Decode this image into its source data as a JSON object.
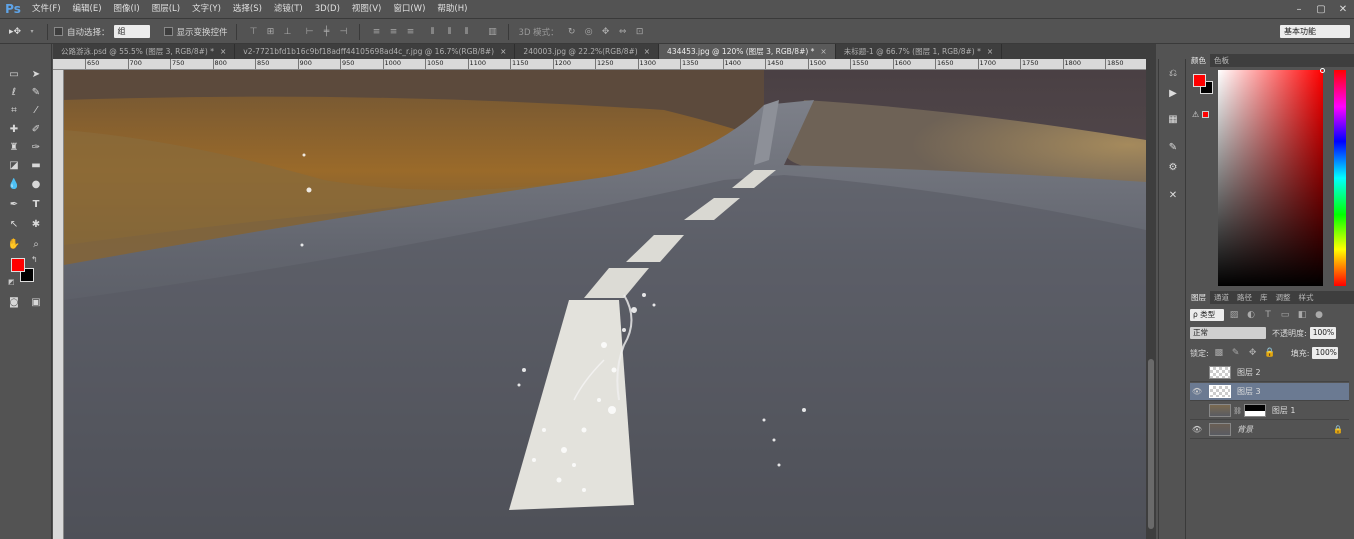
{
  "app": {
    "logo": "Ps"
  },
  "menu": [
    "文件(F)",
    "编辑(E)",
    "图像(I)",
    "图层(L)",
    "文字(Y)",
    "选择(S)",
    "滤镜(T)",
    "3D(D)",
    "视图(V)",
    "窗口(W)",
    "帮助(H)"
  ],
  "window_controls": [
    "–",
    "▢",
    "✕"
  ],
  "options": {
    "auto_select_label": "自动选择：",
    "auto_select_value": "组",
    "show_transform_label": "显示变换控件",
    "mode_3d_label": "3D 模式：",
    "workspace": "基本功能"
  },
  "tabs": [
    {
      "label": "公路游泳.psd @ 55.5% (图层 3, RGB/8#) *",
      "active": false
    },
    {
      "label": "v2-7721bfd1b16c9bf18adff44105698ad4c_r.jpg @ 16.7%(RGB/8#)",
      "active": false
    },
    {
      "label": "240003.jpg @ 22.2%(RGB/8#)",
      "active": false
    },
    {
      "label": "434453.jpg @ 120% (图层 3, RGB/8#) *",
      "active": true
    },
    {
      "label": "未标题-1 @ 66.7% (图层 1, RGB/8#) *",
      "active": false
    }
  ],
  "tab_close": "×",
  "ruler_ticks": [
    "650",
    "700",
    "750",
    "800",
    "850",
    "900",
    "950",
    "1000",
    "1050",
    "1100",
    "1150",
    "1200",
    "1250",
    "1300",
    "1350",
    "1400",
    "1450",
    "1500",
    "1550",
    "1600",
    "1650",
    "1700",
    "1750",
    "1800",
    "1850"
  ],
  "color_panel": {
    "tabs": [
      "颜色",
      "色板"
    ],
    "foreground": "#ff0000",
    "background": "#000000"
  },
  "layers_panel": {
    "tabs": [
      "图层",
      "通道",
      "路径",
      "库",
      "调整",
      "样式"
    ],
    "filter_kind": "ρ 类型",
    "blend_mode": "正常",
    "opacity_label": "不透明度:",
    "opacity_value": "100%",
    "lock_label": "锁定:",
    "fill_label": "填充:",
    "fill_value": "100%",
    "layers": [
      {
        "name": "图层 2",
        "visible": false,
        "selected": false,
        "thumb": "transparent"
      },
      {
        "name": "图层 3",
        "visible": true,
        "selected": true,
        "thumb": "transparent"
      },
      {
        "name": "图层 1",
        "visible": false,
        "selected": false,
        "thumb": "road",
        "mask": true
      },
      {
        "name": "背景",
        "visible": true,
        "selected": false,
        "thumb": "road",
        "locked": true
      }
    ]
  },
  "colors": {
    "accent_blue": "#5fa4e8",
    "selected_layer": "#6b7a92",
    "panel_bg": "#535353"
  }
}
